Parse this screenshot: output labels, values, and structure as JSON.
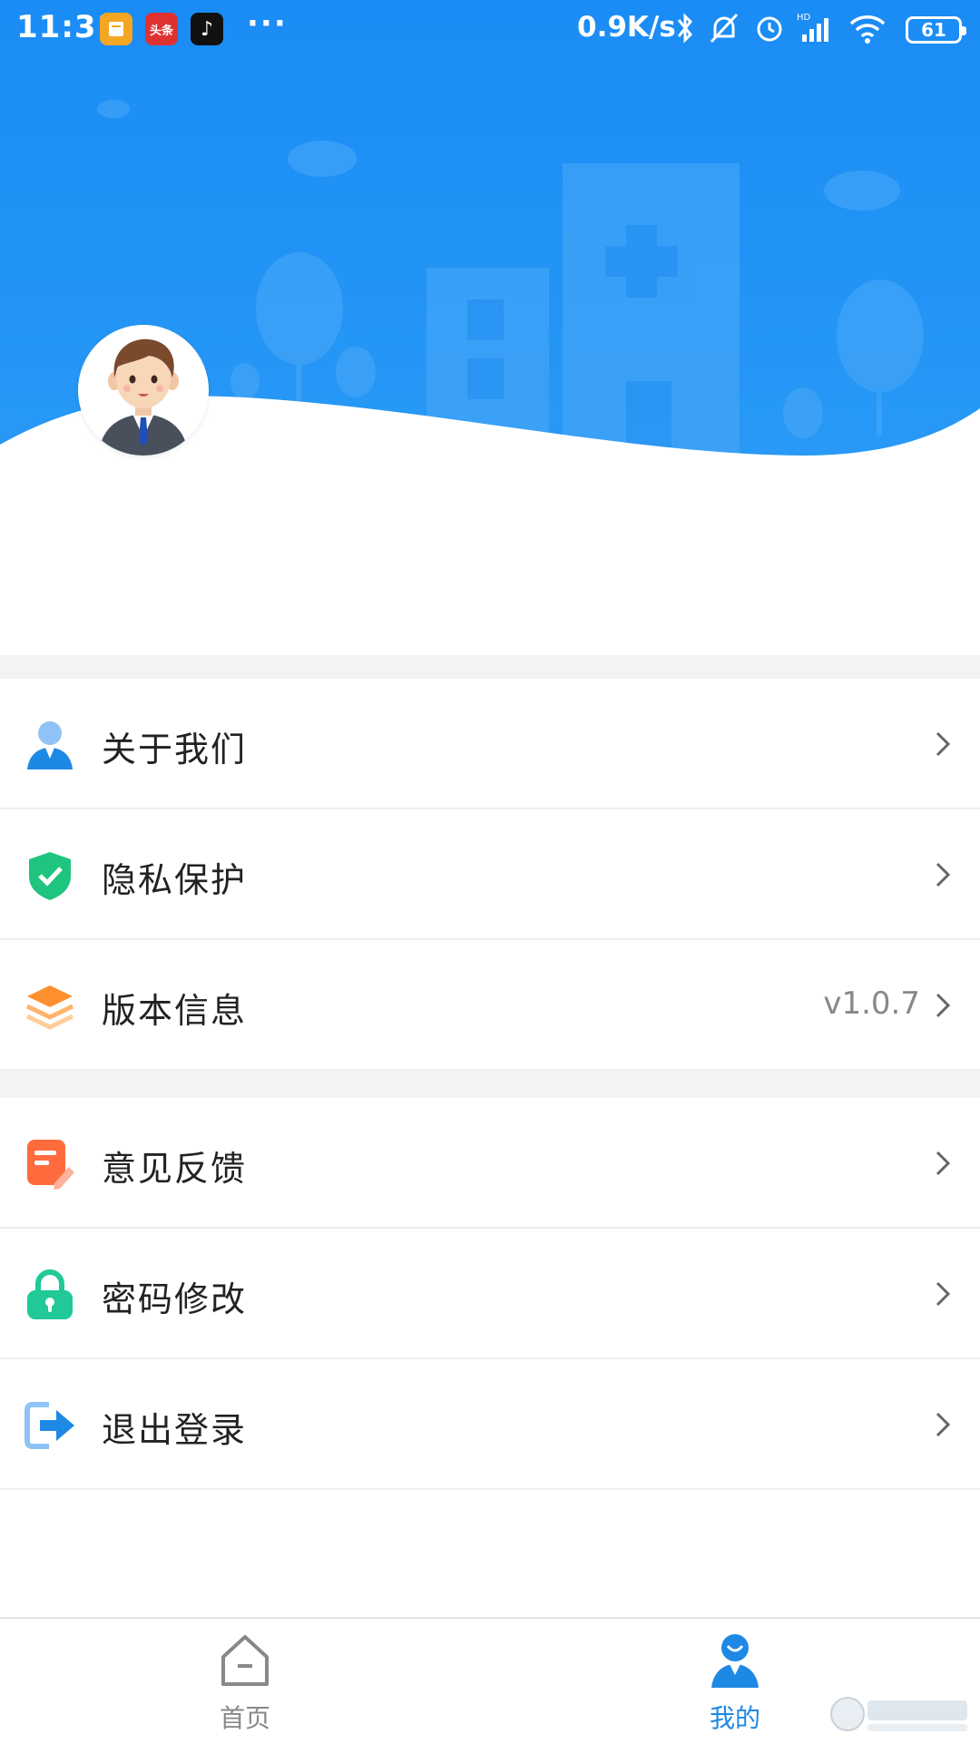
{
  "status_bar": {
    "time": "11:31",
    "apps": [
      {
        "name": "notes-app-icon",
        "color": "#f5a623",
        "text": ""
      },
      {
        "name": "toutiao-app-icon",
        "color": "#e03131",
        "text": "头条"
      },
      {
        "name": "tiktok-app-icon",
        "color": "#111111",
        "text": "♪"
      }
    ],
    "more": "···",
    "network_speed": "0.9K/s",
    "battery": "61"
  },
  "header": {
    "bg_color": "#2196f3",
    "avatar_icon": "user-avatar-icon"
  },
  "menu": {
    "groups": [
      {
        "items": [
          {
            "label": "关于我们",
            "icon": "about-us-icon",
            "value": ""
          },
          {
            "label": "隐私保护",
            "icon": "privacy-shield-icon",
            "value": ""
          },
          {
            "label": "版本信息",
            "icon": "version-layers-icon",
            "value": "v1.0.7"
          }
        ]
      },
      {
        "items": [
          {
            "label": "意见反馈",
            "icon": "feedback-icon",
            "value": ""
          },
          {
            "label": "密码修改",
            "icon": "lock-icon",
            "value": ""
          },
          {
            "label": "退出登录",
            "icon": "logout-icon",
            "value": ""
          }
        ]
      }
    ]
  },
  "tabbar": {
    "tabs": [
      {
        "label": "首页",
        "icon": "home-icon",
        "active": false
      },
      {
        "label": "我的",
        "icon": "mine-person-icon",
        "active": true
      }
    ]
  },
  "colors": {
    "accent": "#1e88e5",
    "divider": "#f2f3f5",
    "shield": "#1fc47e",
    "layers": "#ff9a3c",
    "feedback": "#ff6b3d",
    "lock": "#20c997",
    "logout": "#1e88e5"
  }
}
